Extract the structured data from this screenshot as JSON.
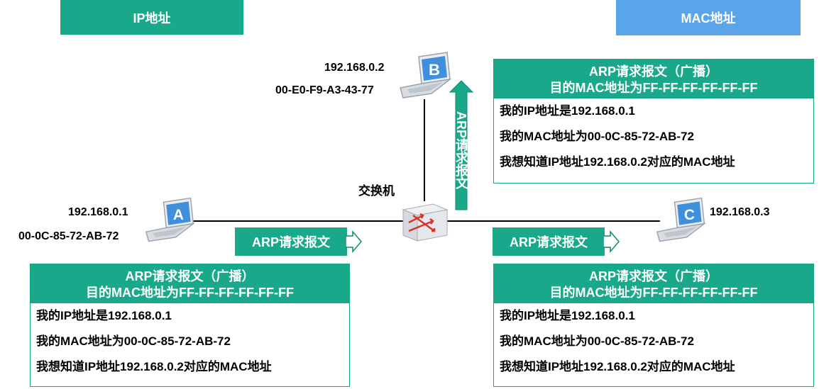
{
  "legend": {
    "ip": {
      "label": "IP地址",
      "color": "#1aa88b"
    },
    "mac": {
      "label": "MAC地址",
      "color": "#5aa5e9"
    }
  },
  "switch": {
    "label": "交换机"
  },
  "hosts": {
    "a": {
      "badge": "A",
      "ip": "192.168.0.1",
      "mac": "00-0C-85-72-AB-72"
    },
    "b": {
      "badge": "B",
      "ip": "192.168.0.2",
      "mac": "00-E0-F9-A3-43-77"
    },
    "c": {
      "badge": "C",
      "ip": "192.168.0.3"
    }
  },
  "arrows": {
    "a_to_switch": "ARP请求报文",
    "switch_to_b": "ARP请求报文",
    "switch_to_c": "ARP请求报文"
  },
  "packets": {
    "left": {
      "title": "ARP请求报文（广播）",
      "dest": "目的MAC地址为FF-FF-FF-FF-FF-FF",
      "lines": [
        "我的IP地址是192.168.0.1",
        "我的MAC地址为00-0C-85-72-AB-72",
        "我想知道IP地址192.168.0.2对应的MAC地址"
      ]
    },
    "top_right": {
      "title": "ARP请求报文（广播）",
      "dest": "目的MAC地址为FF-FF-FF-FF-FF-FF",
      "lines": [
        "我的IP地址是192.168.0.1",
        "我的MAC地址为00-0C-85-72-AB-72",
        "我想知道IP地址192.168.0.2对应的MAC地址"
      ]
    },
    "bottom_right": {
      "title": "ARP请求报文（广播）",
      "dest": "目的MAC地址为FF-FF-FF-FF-FF-FF",
      "lines": [
        "我的IP地址是192.168.0.1",
        "我的MAC地址为00-0C-85-72-AB-72",
        "我想知道IP地址192.168.0.2对应的MAC地址"
      ]
    }
  }
}
